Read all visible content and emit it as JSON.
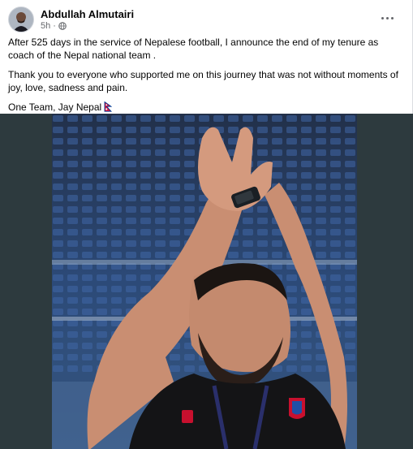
{
  "post": {
    "author": "Abdullah Almutairi",
    "time": "5h",
    "time_separator": "·",
    "paragraphs": [
      "After 525 days in the service of Nepalese football, I announce the end of my tenure as coach of the Nepal national team .",
      "Thank you to everyone who supported me on this journey that was not without moments of joy, love, sadness and pain.",
      "One Team, Jay Nepal"
    ],
    "icons": {
      "audience": "globe-icon",
      "options": "more-options-icon",
      "emoji": "nepal-flag-icon"
    }
  },
  "colors": {
    "media_background": "#2d3a3e",
    "meta_text": "#65676b",
    "flag_red": "#dc143c",
    "flag_blue": "#003893"
  }
}
